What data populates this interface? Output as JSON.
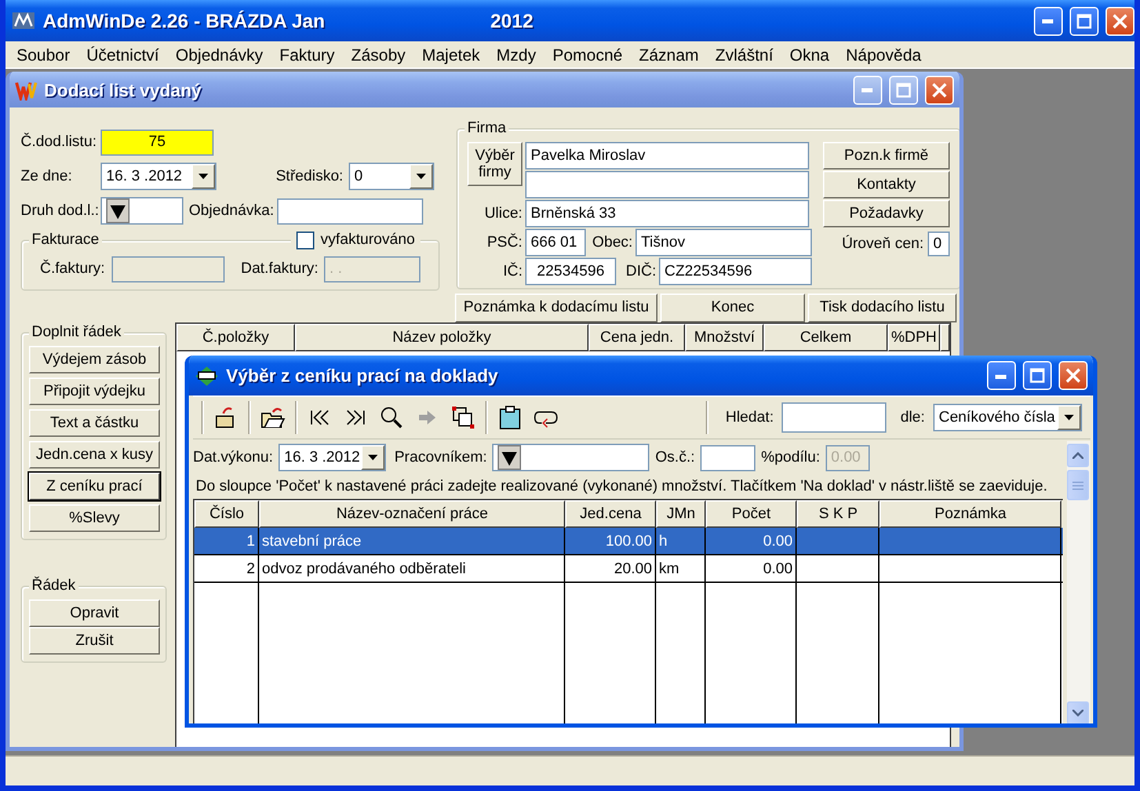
{
  "window": {
    "title": "AdmWinDe 2.26 - BRÁZDA Jan",
    "year": "2012",
    "active": true
  },
  "menu": [
    "Soubor",
    "Účetnictví",
    "Objednávky",
    "Faktury",
    "Zásoby",
    "Majetek",
    "Mzdy",
    "Pomocné",
    "Záznam",
    "Zvláštní",
    "Okna",
    "Nápověda"
  ],
  "delivery_note": {
    "title": "Dodací list vydaný",
    "active": false,
    "number": {
      "label": "Č.dod.listu:",
      "value": "75"
    },
    "date": {
      "label": "Ze dne:",
      "value": "16. 3 .2012"
    },
    "center": {
      "label": "Středisko:",
      "value": "0"
    },
    "note_type": {
      "label": "Druh dod.l.:"
    },
    "order": {
      "label": "Objednávka:"
    },
    "invoicing": {
      "title": "Fakturace",
      "invoiced": {
        "label": "vyfakturováno",
        "checked": false
      },
      "invoice_number": {
        "label": "Č.faktury:",
        "disabled": true
      },
      "invoice_date": {
        "label": "Dat.faktury:",
        "value": ". .",
        "disabled": true
      }
    },
    "firm": {
      "title": "Firma",
      "select_button": "Výběr firmy",
      "name": "Pavelka Miroslav",
      "street": {
        "label": "Ulice:",
        "value": "Brněnská 33"
      },
      "zip": {
        "label": "PSČ:",
        "value": "666 01"
      },
      "city": {
        "label": "Obec:",
        "value": "Tišnov"
      },
      "ic": {
        "label": "IČ:",
        "value": "22534596"
      },
      "dic": {
        "label": "DIČ:",
        "value": "CZ22534596"
      },
      "buttons": [
        "Pozn.k firmě",
        "Kontakty",
        "Požadavky"
      ],
      "price_level": {
        "label": "Úroveň cen:",
        "value": "0"
      }
    },
    "actions": [
      "Poznámka k dodacímu listu",
      "Konec",
      "Tisk dodacího listu"
    ],
    "add_row": {
      "title": "Doplnit řádek",
      "buttons": [
        {
          "label": "Výdejem zásob",
          "focused": false
        },
        {
          "label": "Připojit výdejku",
          "focused": false
        },
        {
          "label": "Text a částku",
          "focused": false
        },
        {
          "label": "Jedn.cena x kusy",
          "focused": false
        },
        {
          "label": "Z ceníku prací",
          "focused": true
        },
        {
          "label": "%Slevy",
          "focused": false
        }
      ]
    },
    "row": {
      "title": "Řádek",
      "buttons": [
        "Opravit",
        "Zrušit"
      ]
    },
    "items_table": {
      "columns": [
        "Č.položky",
        "Název položky",
        "Cena jedn.",
        "Množství",
        "Celkem",
        "%DPH"
      ]
    }
  },
  "price_list_dialog": {
    "title": "Výběr z ceníku prací na doklady",
    "active": true,
    "search": {
      "label": "Hledat:"
    },
    "search_by": {
      "label": "dle:",
      "value": "Ceníkového čísla"
    },
    "work_date": {
      "label": "Dat.výkonu:",
      "value": "16. 3 .2012"
    },
    "worker": {
      "label": "Pracovníkem:"
    },
    "personal_number": {
      "label": "Os.č.:"
    },
    "share": {
      "label": "%podílu:",
      "value": "0.00",
      "disabled": true
    },
    "hint": "Do sloupce 'Počet' k nastavené práci zadejte realizované (vykonané) množství. Tlačítkem 'Na doklad' v nástr.liště se zaeviduje.",
    "columns": [
      "Číslo",
      "Název-označení práce",
      "Jed.cena",
      "JMn",
      "Počet",
      "S K P",
      "Poznámka"
    ],
    "rows": [
      {
        "number": "1",
        "name": "stavební práce",
        "price": "100.00",
        "unit": "h",
        "count": "0.00",
        "selected": true
      },
      {
        "number": "2",
        "name": "odvoz prodávaného odběrateli",
        "price": "20.00",
        "unit": "km",
        "count": "0.00",
        "selected": false
      }
    ]
  }
}
